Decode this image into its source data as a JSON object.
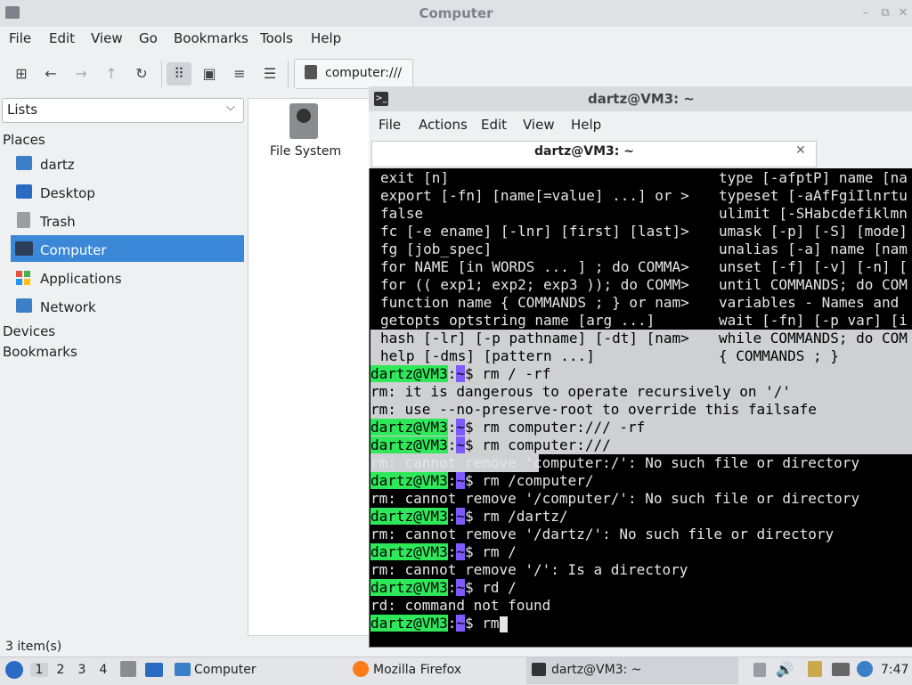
{
  "file_manager": {
    "title": "Computer",
    "menu": [
      "File",
      "Edit",
      "View",
      "Go",
      "Bookmarks",
      "Tools",
      "Help"
    ],
    "address": "computer:///",
    "side_pane_mode": "Lists",
    "places_header": "Places",
    "places": [
      "dartz",
      "Desktop",
      "Trash",
      "Computer",
      "Applications",
      "Network"
    ],
    "selected_place": "Computer",
    "devices_header": "Devices",
    "bookmarks_header": "Bookmarks",
    "items": [
      "File System"
    ],
    "status": "3 item(s)"
  },
  "terminal": {
    "title": "dartz@VM3: ~",
    "menu": [
      "File",
      "Actions",
      "Edit",
      "View",
      "Help"
    ],
    "tab_label": "dartz@VM3: ~",
    "prompt_user": "dartz@VM3",
    "prompt_colon": ":",
    "prompt_path": "~",
    "prompt_dollar": "$",
    "builtins_left": [
      "exit [n]",
      "export [-fn] [name[=value] ...] or >",
      "false",
      "fc [-e ename] [-lnr] [first] [last]>",
      "fg [job_spec]",
      "for NAME [in WORDS ... ] ; do COMMA>",
      "for (( exp1; exp2; exp3 )); do COMM>",
      "function name { COMMANDS ; } or nam>",
      "getopts optstring name [arg ...]",
      "hash [-lr] [-p pathname] [-dt] [nam>",
      "help [-dms] [pattern ...]"
    ],
    "builtins_right": [
      "type [-afptP] name [na",
      "typeset [-aAfFgiIlnrtu",
      "ulimit [-SHabcdefiklmn",
      "umask [-p] [-S] [mode]",
      "unalias [-a] name [nam",
      "unset [-f] [-v] [-n] [",
      "until COMMANDS; do COM",
      "variables - Names and",
      "wait [-fn] [-p var] [i",
      "while COMMANDS; do COM",
      "{ COMMANDS ; }"
    ],
    "session": [
      {
        "cmd": " rm / -rf"
      },
      {
        "out": "rm: it is dangerous to operate recursively on '/'"
      },
      {
        "out": "rm: use --no-preserve-root to override this failsafe"
      },
      {
        "cmd": " rm computer:/// -rf"
      },
      {
        "cmd": " rm computer:///"
      },
      {
        "out": "rm: cannot remove 'computer:/': No such file or directory"
      },
      {
        "cmd": " rm /computer/"
      },
      {
        "out": "rm: cannot remove '/computer/': No such file or directory"
      },
      {
        "cmd": " rm /dartz/"
      },
      {
        "out": "rm: cannot remove '/dartz/': No such file or directory"
      },
      {
        "cmd": " rm /"
      },
      {
        "out": "rm: cannot remove '/': Is a directory"
      },
      {
        "cmd": " rd /"
      },
      {
        "out": "rd: command not found"
      },
      {
        "cmd": " rm"
      }
    ]
  },
  "taskbar": {
    "workspaces": [
      "1",
      "2",
      "3",
      "4"
    ],
    "tasks": [
      "Computer",
      "Mozilla Firefox",
      "dartz@VM3: ~"
    ],
    "clock": "7:47"
  },
  "colors": {
    "selection": "#3c88d8",
    "prompt_user_bg": "#2ee85a",
    "prompt_path_bg": "#7c5cff",
    "terminal_bg": "#000000",
    "terminal_highlight": "#cfd0d1"
  }
}
